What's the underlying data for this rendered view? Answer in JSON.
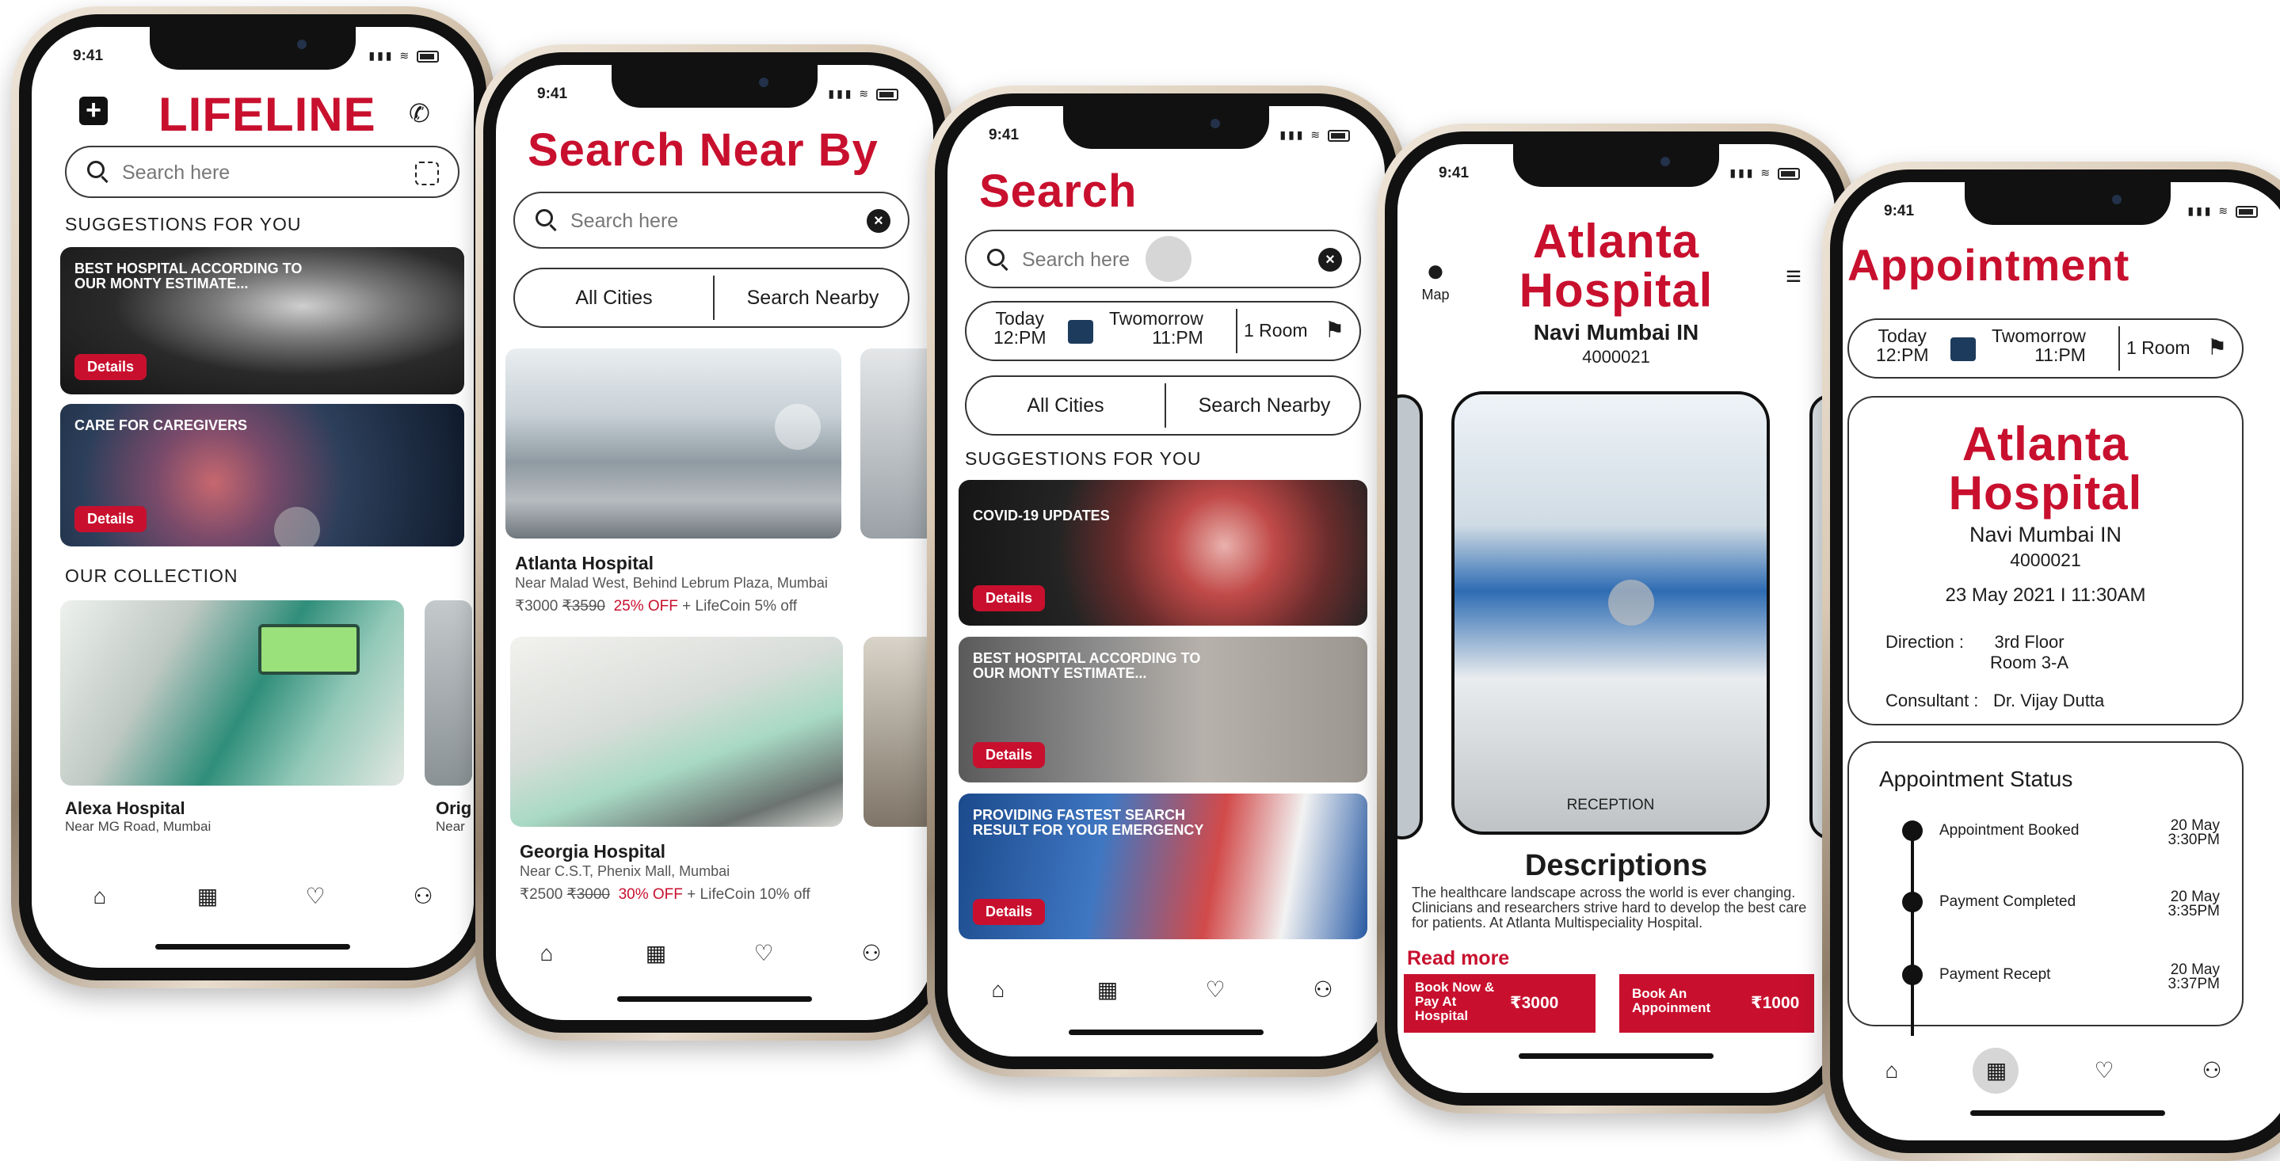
{
  "status_time": "9:41",
  "phone1": {
    "app_title": "LIFELINE",
    "search_placeholder": "Search here",
    "section_suggestions": "SUGGESTIONS FOR YOU",
    "card1_title": "BEST HOSPITAL ACCORDING TO OUR MONTY ESTIMATE...",
    "card2_title": "CARE FOR CAREGIVERS",
    "details_label": "Details",
    "section_collection": "OUR COLLECTION",
    "hospital_name": "Alexa Hospital",
    "hospital_address": "Near MG Road,  Mumbai",
    "hospital2_name": "Orig",
    "hospital2_address": "Near"
  },
  "phone2": {
    "title": "Search Near By",
    "search_placeholder": "Search here",
    "city_filter": "All Cities",
    "nearby_filter": "Search Nearby",
    "hospital1_name": "Atlanta Hospital",
    "hospital1_address": "Near Malad West, Behind Lebrum Plaza, Mumbai",
    "hospital1_price": "₹3000",
    "hospital1_old_price": "₹3590",
    "hospital1_discount": "25% OFF",
    "hospital1_coin": "+  LifeCoin 5% off",
    "hospital2_name": "Georgia Hospital",
    "hospital2_address": "Near C.S.T, Phenix Mall, Mumbai",
    "hospital2_price": "₹2500",
    "hospital2_old_price": "₹3000",
    "hospital2_discount": "30% OFF",
    "hospital2_coin": "+  LifeCoin 10% off"
  },
  "phone3": {
    "title": "Search",
    "search_placeholder": "Search here",
    "date_today": "Today",
    "time_today": "12:PM",
    "date_tomorrow": "Twomorrow",
    "time_tomorrow": "11:PM",
    "rooms": "1 Room",
    "city_filter": "All Cities",
    "nearby_filter": "Search Nearby",
    "section_suggestions": "SUGGESTIONS FOR YOU",
    "card1_title": "COVID-19 UPDATES",
    "card2_title": "BEST HOSPITAL ACCORDING TO OUR MONTY ESTIMATE...",
    "card3_title": "PROVIDING FASTEST SEARCH RESULT FOR YOUR EMERGENCY",
    "details_label": "Details"
  },
  "phone4": {
    "map_label": "Map",
    "hospital_name_line1": "Atlanta",
    "hospital_name_line2": "Hospital",
    "city": "Navi Mumbai IN",
    "pincode": "4000021",
    "photo_caption": "RECEPTION",
    "descriptions_heading": "Descriptions",
    "description_text": "The healthcare landscape across the world is ever changing. Clinicians and researchers strive hard to develop the best care for patients. At Atlanta Multispeciality Hospital.",
    "read_more": "Read more",
    "book_pay_label": "Book Now & Pay At Hospital",
    "book_pay_price": "₹3000",
    "book_appt_label": "Book An Appoinment",
    "book_appt_price": "₹1000"
  },
  "phone5": {
    "title": "Appointment",
    "date_today": "Today",
    "time_today": "12:PM",
    "date_tomorrow": "Twomorrow",
    "time_tomorrow": "11:PM",
    "rooms": "1 Room",
    "hospital_name_line1": "Atlanta",
    "hospital_name_line2": "Hospital",
    "city": "Navi Mumbai IN",
    "pincode": "4000021",
    "datetime": "23 May 2021  I 11:30AM",
    "direction_label": "Direction  :",
    "direction_line1": "3rd Floor",
    "direction_line2": "Room 3-A",
    "consultant_label": "Consultant  :",
    "consultant_value": "Dr. Vijay Dutta",
    "status_heading": "Appointment Status",
    "steps": [
      {
        "label": "Appointment Booked",
        "date": "20 May",
        "time": "3:30PM"
      },
      {
        "label": "Payment Completed",
        "date": "20 May",
        "time": "3:35PM"
      },
      {
        "label": "Payment Recept",
        "date": "20 May",
        "time": "3:37PM"
      }
    ]
  },
  "colors": {
    "accent": "#c8102e",
    "text": "#1c1c1c"
  },
  "icons": [
    "hospital-cross-icon",
    "phone-icon",
    "search-icon",
    "scan-icon",
    "clear-icon",
    "home-icon",
    "calendar-icon",
    "heart-icon",
    "profile-icon",
    "map-pin-icon",
    "menu-icon",
    "bed-icon",
    "person-icon"
  ]
}
